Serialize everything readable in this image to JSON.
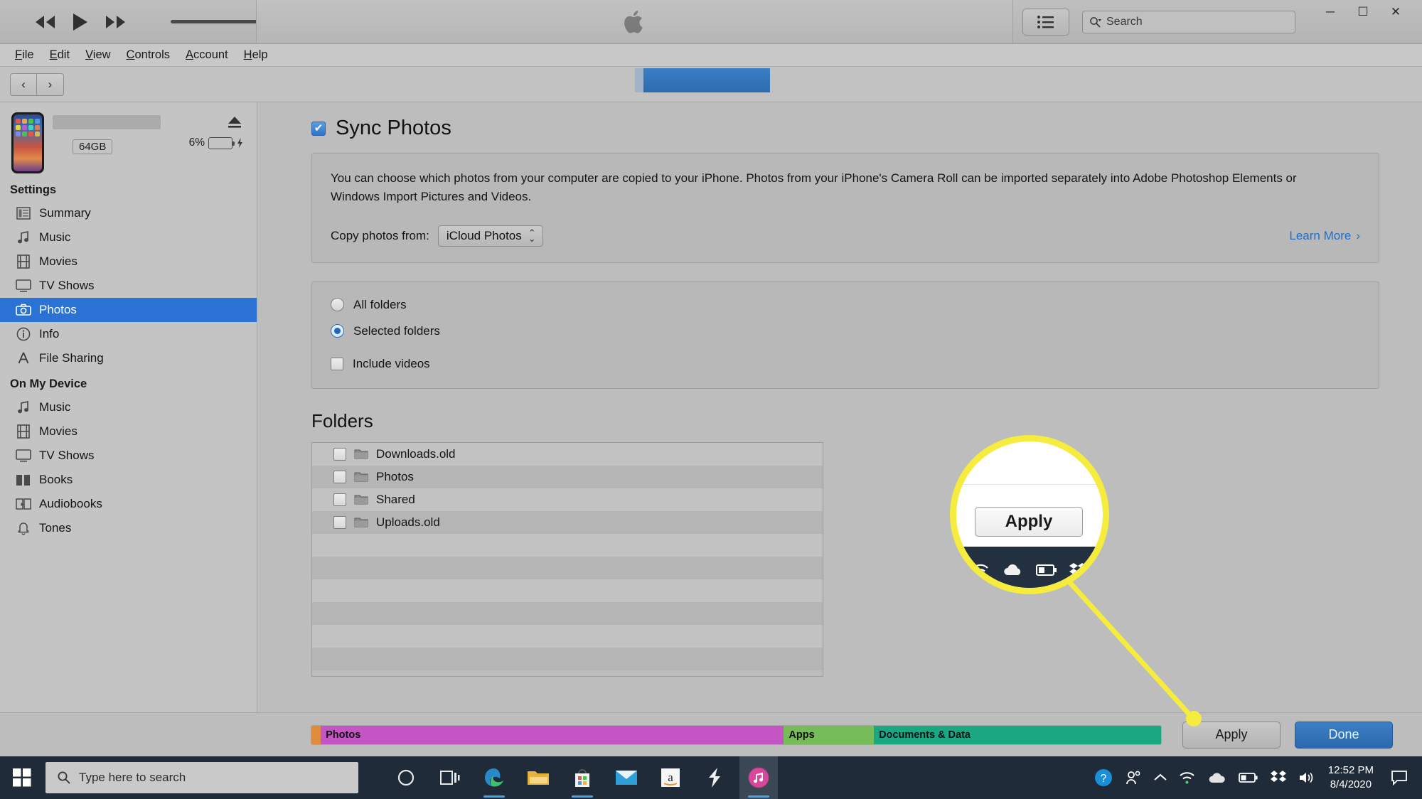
{
  "toolbar": {
    "rewind_icon": "rewind-icon",
    "play_icon": "play-icon",
    "fastforward_icon": "fast-forward-icon",
    "volume_icon": "volume-slider",
    "airplay_icon": "airplay-icon",
    "apple_logo_icon": "apple-logo-icon",
    "list_view_icon": "list-view-icon",
    "search_icon": "search-icon",
    "search_placeholder": "Search",
    "minimize_label": "─",
    "maximize_label": "☐",
    "close_label": "✕"
  },
  "menubar": {
    "items": [
      {
        "label": "File",
        "accel": "F"
      },
      {
        "label": "Edit",
        "accel": "E"
      },
      {
        "label": "View",
        "accel": "V"
      },
      {
        "label": "Controls",
        "accel": "C"
      },
      {
        "label": "Account",
        "accel": "A"
      },
      {
        "label": "Help",
        "accel": "H"
      }
    ]
  },
  "navbar": {
    "back_label": "‹",
    "forward_label": "›"
  },
  "sidebar": {
    "device": {
      "capacity": "64GB",
      "battery_percent": "6%",
      "battery_fill_pct": 12,
      "eject_icon": "eject-icon",
      "name_redacted": true
    },
    "groups": [
      {
        "title": "Settings",
        "items": [
          {
            "label": "Summary",
            "icon": "summary-icon",
            "active": false
          },
          {
            "label": "Music",
            "icon": "music-note-icon",
            "active": false
          },
          {
            "label": "Movies",
            "icon": "film-icon",
            "active": false
          },
          {
            "label": "TV Shows",
            "icon": "tv-icon",
            "active": false
          },
          {
            "label": "Photos",
            "icon": "camera-icon",
            "active": true
          },
          {
            "label": "Info",
            "icon": "info-icon",
            "active": false
          },
          {
            "label": "File Sharing",
            "icon": "appstore-a-icon",
            "active": false
          }
        ]
      },
      {
        "title": "On My Device",
        "items": [
          {
            "label": "Music",
            "icon": "music-note-icon",
            "active": false
          },
          {
            "label": "Movies",
            "icon": "film-icon",
            "active": false
          },
          {
            "label": "TV Shows",
            "icon": "tv-icon",
            "active": false
          },
          {
            "label": "Books",
            "icon": "books-icon",
            "active": false
          },
          {
            "label": "Audiobooks",
            "icon": "audiobook-icon",
            "active": false
          },
          {
            "label": "Tones",
            "icon": "bell-icon",
            "active": false
          }
        ]
      }
    ]
  },
  "main": {
    "sync_photos_label": "Sync Photos",
    "sync_photos_checked": true,
    "description": "You can choose which photos from your computer are copied to your iPhone. Photos from your iPhone's Camera Roll can be imported separately into Adobe Photoshop Elements or Windows Import Pictures and Videos.",
    "copy_from_label": "Copy photos from:",
    "copy_from_value": "iCloud Photos",
    "learn_more_label": "Learn More",
    "learn_more_chevron": "›",
    "learn_more_color": "#1a6fd4",
    "options": [
      {
        "label": "All folders",
        "type": "radio",
        "selected": false
      },
      {
        "label": "Selected folders",
        "type": "radio",
        "selected": true
      },
      {
        "label": "Include videos",
        "type": "checkbox",
        "selected": false
      }
    ],
    "folders_heading": "Folders",
    "folders": [
      {
        "name": "Downloads.old",
        "checked": false
      },
      {
        "name": "Photos",
        "checked": false
      },
      {
        "name": "Shared",
        "checked": false
      },
      {
        "name": "Uploads.old",
        "checked": false
      }
    ]
  },
  "bottom": {
    "capacity_segments": [
      {
        "label": "",
        "color": "#e08a3c",
        "width_pct": 1.1
      },
      {
        "label": "Photos",
        "color": "#c455c4",
        "width_pct": 54.5
      },
      {
        "label": "Apps",
        "color": "#76bd5a",
        "width_pct": 10.6
      },
      {
        "label": "Documents & Data",
        "color": "#1aa882",
        "width_pct": 33.8
      }
    ],
    "apply_label": "Apply",
    "done_label": "Done"
  },
  "callout": {
    "apply_label": "Apply",
    "ring_color": "#f5ec3d",
    "tray_icons": [
      "wifi-icon",
      "onedrive-cloud-icon",
      "battery-icon",
      "dropbox-icon"
    ]
  },
  "taskbar": {
    "start_icon": "windows-start-icon",
    "search_icon": "search-icon",
    "search_placeholder": "Type here to search",
    "apps": [
      {
        "name": "cortana-icon",
        "running": false
      },
      {
        "name": "task-view-icon",
        "running": false
      },
      {
        "name": "edge-icon",
        "running": true
      },
      {
        "name": "file-explorer-icon",
        "running": false
      },
      {
        "name": "microsoft-store-icon",
        "running": true
      },
      {
        "name": "mail-icon",
        "running": false
      },
      {
        "name": "amazon-icon",
        "running": false
      },
      {
        "name": "lightning-icon",
        "running": false
      },
      {
        "name": "itunes-icon",
        "running": true
      }
    ],
    "tray": {
      "help_icon": "help-circle-icon",
      "people_icon": "people-icon",
      "chevron_icon": "chevron-up-icon",
      "wifi_icon": "wifi-icon",
      "onedrive_icon": "onedrive-cloud-icon",
      "battery_icon": "battery-icon",
      "dropbox_icon": "dropbox-icon",
      "volume_icon": "volume-icon",
      "time": "12:52 PM",
      "date": "8/4/2020",
      "notification_icon": "notification-icon"
    }
  }
}
